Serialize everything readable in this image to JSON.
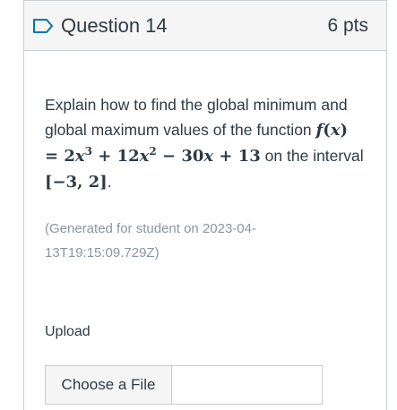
{
  "question": {
    "title": "Question 14",
    "points": "6 pts",
    "text_before": "Explain how to find the global minimum and global maximum values of the function ",
    "function_expr": "f(x) = 2x³ + 12x² − 30x + 13",
    "text_middle": " on the interval ",
    "interval": "[−3, 2]",
    "text_end": ".",
    "generated_note": "(Generated for student on 2023-04-13T19:15:09.729Z)"
  },
  "upload": {
    "label": "Upload",
    "choose_file_label": "Choose a File"
  },
  "icons": {
    "flag": "flag-outline-icon"
  },
  "colors": {
    "accent": "#0374b5",
    "text": "#2d3b45",
    "muted": "#8b969e",
    "border": "#c7cdd1",
    "header_bg": "#f5f5f5"
  }
}
